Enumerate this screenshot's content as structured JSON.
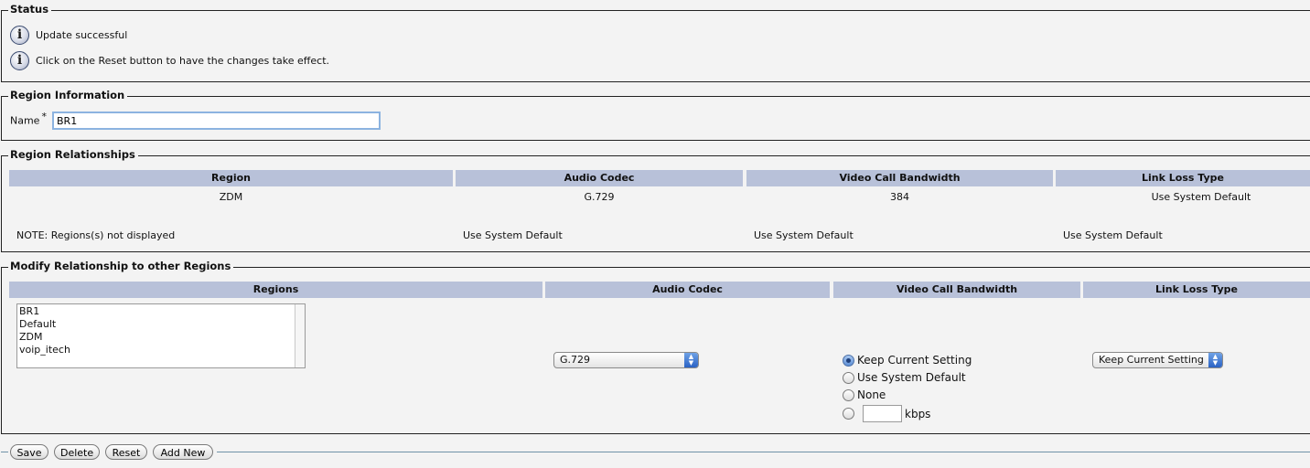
{
  "status": {
    "legend": "Status",
    "messages": [
      "Update successful",
      "Click on the Reset button to have the changes take effect."
    ]
  },
  "region_info": {
    "legend": "Region Information",
    "name_label": "Name",
    "required_marker": "*",
    "name_value": "BR1"
  },
  "relationships": {
    "legend": "Region Relationships",
    "columns": [
      "Region",
      "Audio Codec",
      "Video Call Bandwidth",
      "Link Loss Type"
    ],
    "row": [
      "ZDM",
      "G.729",
      "384",
      "Use System Default"
    ],
    "note": "NOTE: Regions(s) not displayed",
    "note_values": [
      "Use System Default",
      "Use System Default",
      "Use System Default"
    ]
  },
  "modify": {
    "legend": "Modify Relationship to other Regions",
    "columns": [
      "Regions",
      "Audio Codec",
      "Video Call Bandwidth",
      "Link Loss Type"
    ],
    "regions_list": [
      "BR1",
      "Default",
      "ZDM",
      "voip_itech"
    ],
    "audio_codec_selected": "G.729",
    "bandwidth_options": [
      "Keep Current Setting",
      "Use System Default",
      "None"
    ],
    "bandwidth_selected": "Keep Current Setting",
    "kbps_unit": "kbps",
    "link_loss_selected": "Keep Current Setting"
  },
  "buttons": {
    "save": "Save",
    "delete": "Delete",
    "reset": "Reset",
    "add_new": "Add New"
  }
}
